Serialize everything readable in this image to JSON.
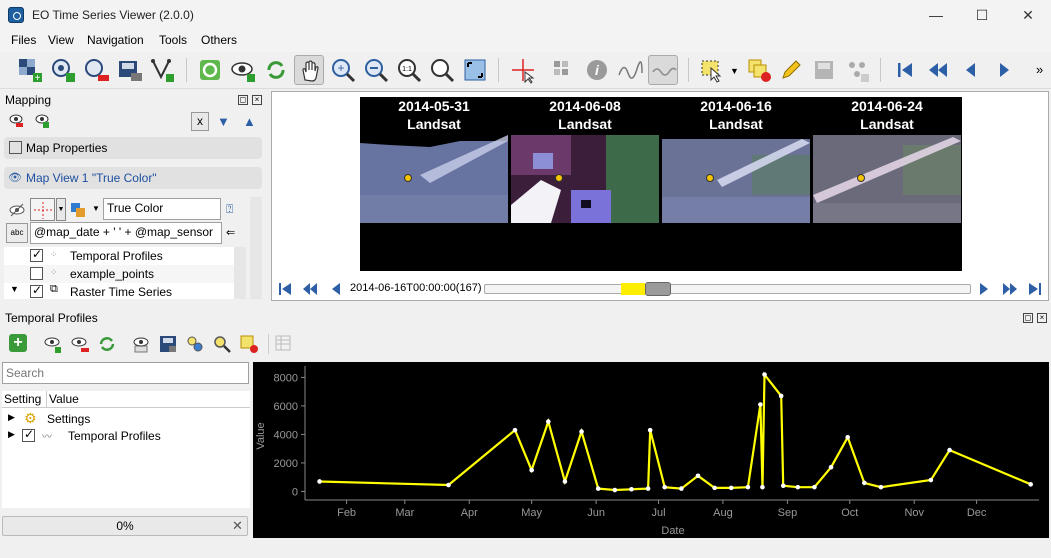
{
  "window": {
    "title": "EO Time Series Viewer (2.0.0)",
    "minimize": "—",
    "maximize": "☐",
    "close": "✕"
  },
  "menu": [
    "Files",
    "View",
    "Navigation",
    "Tools",
    "Others"
  ],
  "toolbar": {
    "icons": [
      "add-raster-icon",
      "add-remote-icon",
      "remove-raster-icon",
      "save-raster-icon",
      "add-vector-icon",
      "qgis-sync-icon",
      "show-map-icon",
      "refresh-icon",
      "pan-icon",
      "zoom-in-icon",
      "zoom-out-icon",
      "zoom-native-icon",
      "zoom-layer-icon",
      "zoom-full-icon",
      "crosshair-icon",
      "select-pixel-icon",
      "info-icon",
      "spectral-profile-icon",
      "temporal-profile-icon",
      "select-feature-icon",
      "deselect-icon",
      "edit-icon",
      "save-edits-icon",
      "add-feature-icon",
      "first-date-icon",
      "previous-page-icon",
      "previous-date-icon",
      "next-date-icon"
    ],
    "overflow": "»"
  },
  "mapping": {
    "title": "Mapping",
    "clear_label": "x",
    "map_properties": "Map Properties",
    "map_view": "Map View 1 \"True Color\"",
    "band_combination": "True Color",
    "label_expression": "@map_date + ' ' + @map_sensor",
    "layers": [
      {
        "name": "Temporal Profiles",
        "checked": true
      },
      {
        "name": "example_points",
        "checked": false
      },
      {
        "name": "Raster Time Series",
        "checked": true
      }
    ]
  },
  "map": {
    "tiles": [
      {
        "date": "2014-05-31",
        "sensor": "Landsat"
      },
      {
        "date": "2014-06-08",
        "sensor": "Landsat"
      },
      {
        "date": "2014-06-16",
        "sensor": "Landsat"
      },
      {
        "date": "2014-06-24",
        "sensor": "Landsat"
      }
    ],
    "current_time": "2014-06-16T00:00:00(167)",
    "slider_position": 0.33
  },
  "temporal_profiles": {
    "title": "Temporal Profiles",
    "search_placeholder": "Search",
    "columns": [
      "Setting",
      "Value"
    ],
    "tree": [
      {
        "label": "Settings"
      },
      {
        "label": "Temporal Profiles",
        "checked": true
      }
    ],
    "progress": "0%",
    "progress_clear": "✕"
  },
  "chart_data": {
    "type": "line",
    "xlabel": "Date",
    "ylabel": "Value",
    "x_ticks": [
      "Feb",
      "Mar",
      "Apr",
      "May",
      "Jun",
      "Jul",
      "Aug",
      "Sep",
      "Oct",
      "Nov",
      "Dec"
    ],
    "y_ticks": [
      0,
      2000,
      4000,
      6000,
      8000
    ],
    "ylim": [
      -600,
      8800
    ],
    "xlim": [
      "2014-01-12",
      "2014-12-31"
    ],
    "line_color": "#ffff00",
    "background": "#000000",
    "series": [
      {
        "points": [
          [
            "2014-01-19",
            700
          ],
          [
            "2014-03-22",
            450
          ],
          [
            "2014-04-23",
            4300
          ],
          [
            "2014-05-01",
            1500
          ],
          [
            "2014-05-09",
            4900
          ],
          [
            "2014-05-17",
            700
          ],
          [
            "2014-05-25",
            4200
          ],
          [
            "2014-06-02",
            200
          ],
          [
            "2014-06-10",
            100
          ],
          [
            "2014-06-18",
            150
          ],
          [
            "2014-06-26",
            200
          ],
          [
            "2014-06-27",
            4300
          ],
          [
            "2014-07-04",
            300
          ],
          [
            "2014-07-12",
            200
          ],
          [
            "2014-07-20",
            1100
          ],
          [
            "2014-07-28",
            250
          ],
          [
            "2014-08-05",
            250
          ],
          [
            "2014-08-13",
            300
          ],
          [
            "2014-08-19",
            6100
          ],
          [
            "2014-08-20",
            300
          ],
          [
            "2014-08-21",
            8200
          ],
          [
            "2014-08-29",
            6700
          ],
          [
            "2014-08-30",
            400
          ],
          [
            "2014-09-06",
            300
          ],
          [
            "2014-09-14",
            300
          ],
          [
            "2014-09-22",
            1700
          ],
          [
            "2014-09-30",
            3800
          ],
          [
            "2014-10-08",
            600
          ],
          [
            "2014-10-16",
            300
          ],
          [
            "2014-11-09",
            800
          ],
          [
            "2014-11-18",
            2900
          ],
          [
            "2014-12-27",
            500
          ]
        ]
      }
    ]
  }
}
